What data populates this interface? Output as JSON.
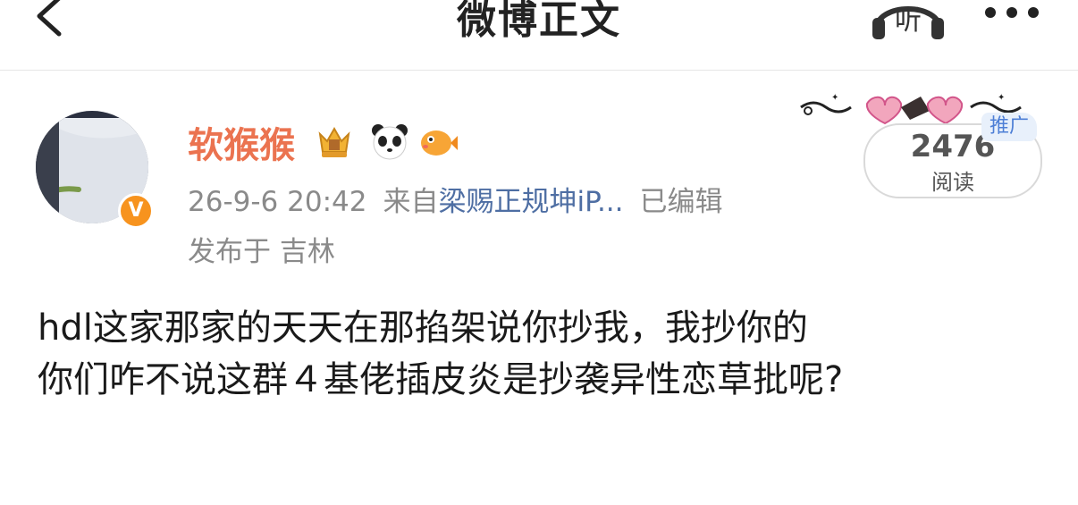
{
  "header": {
    "title": "微博正文",
    "listen_label": "听"
  },
  "author": {
    "name": "软猴猴",
    "verified_mark": "V",
    "badges": [
      "crown-badge-icon",
      "panda-icon",
      "pufferfish-icon"
    ]
  },
  "post_meta": {
    "time": "26-9-6 20:42",
    "source_prefix": "来自",
    "source": "梁赐正规坤iP...",
    "edited": "已编辑",
    "location": "发布于 吉林"
  },
  "stats": {
    "reads_count": "2476",
    "reads_label": "阅读",
    "promo_label": "推广"
  },
  "post": {
    "lines": [
      "hdl这家那家的天天在那掐架说你抄我，我抄你的",
      "你们咋不说这群４基佬插皮炎是抄袭异性恋草批呢?"
    ]
  },
  "colors": {
    "username": "#eb7350",
    "link": "#4e6ea3",
    "meta_gray": "#8a8a8a",
    "verified": "#f7931e",
    "promo": "#4e7fd6"
  }
}
